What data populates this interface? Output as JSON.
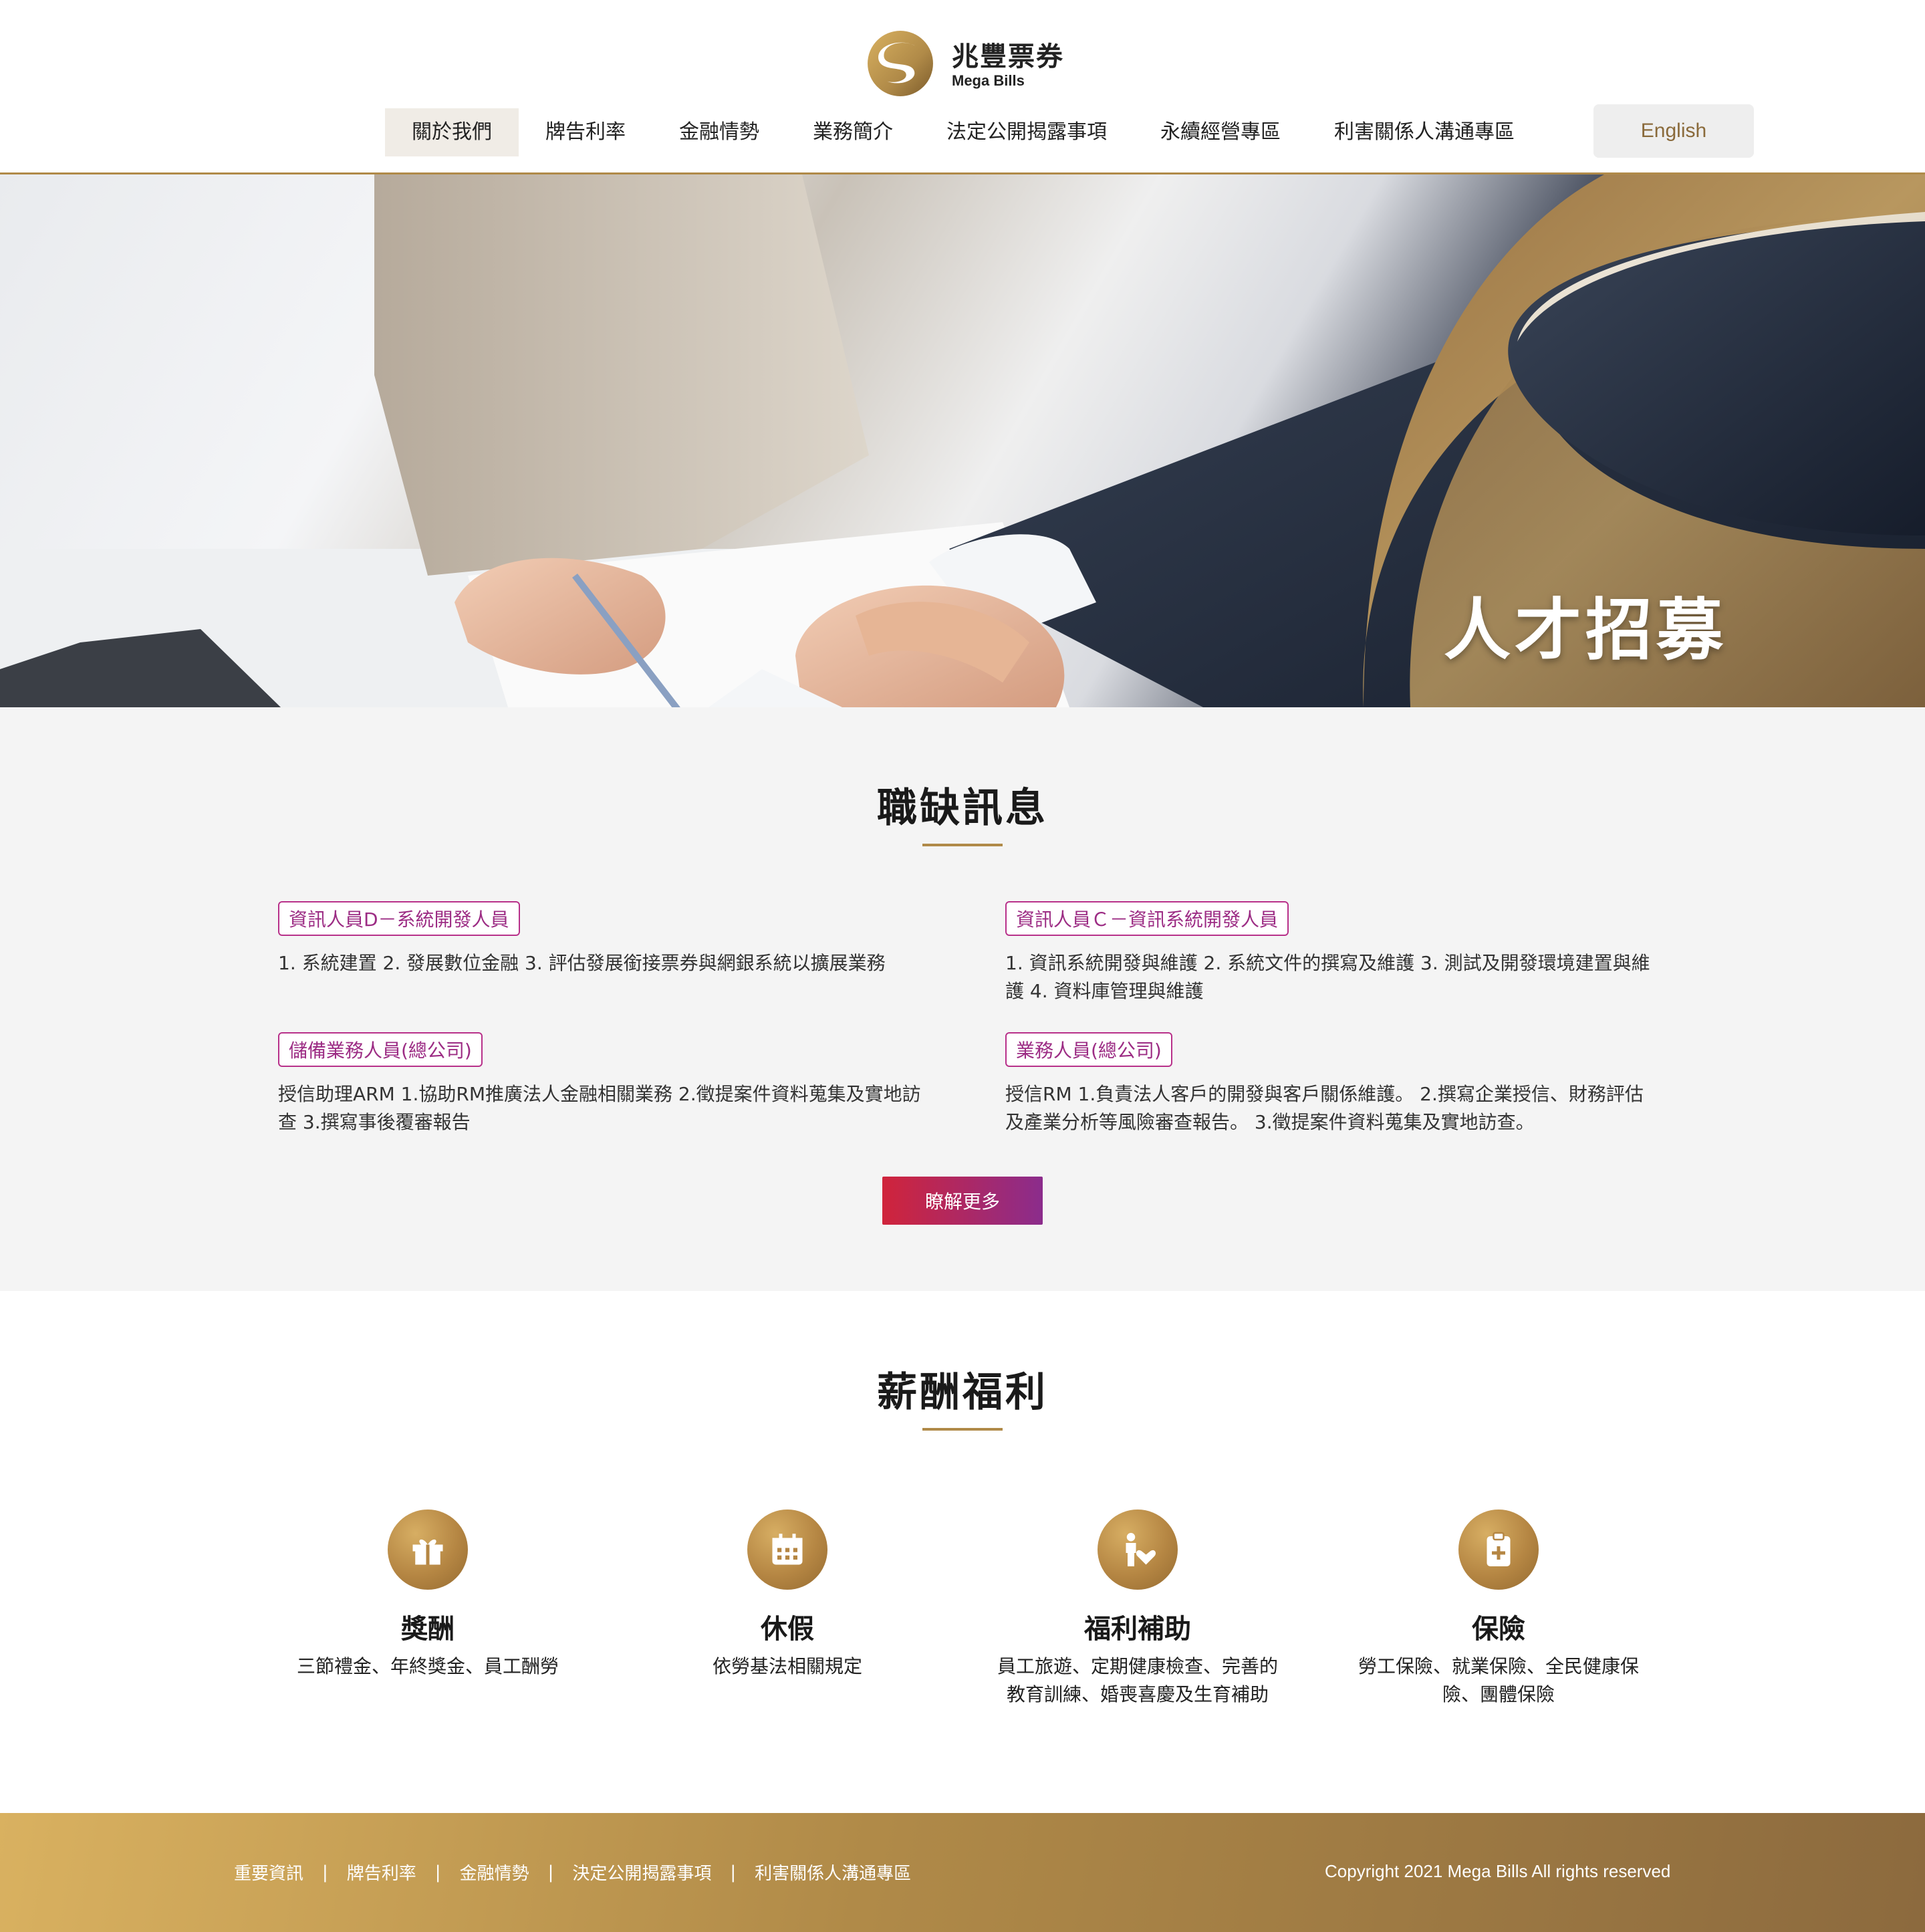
{
  "brand": {
    "name_zh": "兆豐票券",
    "name_en": "Mega Bills",
    "gold": "#b08a48",
    "gold_light": "#d9b160",
    "accent_red": "#d0243b",
    "accent_purple": "#8b2c8c"
  },
  "nav": {
    "items": [
      {
        "label": "關於我們",
        "active": true
      },
      {
        "label": "牌告利率"
      },
      {
        "label": "金融情勢"
      },
      {
        "label": "業務簡介"
      },
      {
        "label": "法定公開揭露事項"
      },
      {
        "label": "永續經營專區"
      },
      {
        "label": "利害關係人溝通專區"
      }
    ],
    "language_button": "English"
  },
  "hero": {
    "title": "人才招募"
  },
  "jobs": {
    "title": "職缺訊息",
    "items": [
      {
        "tag": "資訊人員D－系統開發人員",
        "desc": "1. 系統建置 2. 發展數位金融 3. 評估發展銜接票券與網銀系統以擴展業務"
      },
      {
        "tag": "資訊人員Ｃ－資訊系統開發人員",
        "desc": "1. 資訊系統開發與維護 2. 系統文件的撰寫及維護 3. 測試及開發環境建置與維護 4. 資料庫管理與維護"
      },
      {
        "tag": "儲備業務人員(總公司)",
        "desc": "授信助理ARM 1.協助RM推廣法人金融相關業務 2.徵提案件資料蒐集及實地訪查 3.撰寫事後覆審報告"
      },
      {
        "tag": "業務人員(總公司)",
        "desc": "授信RM 1.負責法人客戶的開發與客戶關係維護。 2.撰寫企業授信、財務評估及產業分析等風險審查報告。 3.徵提案件資料蒐集及實地訪查。"
      }
    ],
    "more_button": "瞭解更多"
  },
  "benefits": {
    "title": "薪酬福利",
    "items": [
      {
        "icon": "gift-icon",
        "name": "獎酬",
        "desc": "三節禮金、年終獎金、員工酬勞"
      },
      {
        "icon": "calendar-icon",
        "name": "休假",
        "desc": "依勞基法相關規定"
      },
      {
        "icon": "care-icon",
        "name": "福利補助",
        "desc": "員工旅遊、定期健康檢查、完善的教育訓練、婚喪喜慶及生育補助"
      },
      {
        "icon": "medical-clipboard-icon",
        "name": "保險",
        "desc": "勞工保險、就業保險、全民健康保險、團體保險"
      }
    ]
  },
  "footer": {
    "links": [
      "重要資訊",
      "牌告利率",
      "金融情勢",
      "決定公開揭露事項",
      "利害關係人溝通專區"
    ],
    "separator": "|",
    "copyright": "Copyright 2021 Mega Bills All rights reserved"
  }
}
